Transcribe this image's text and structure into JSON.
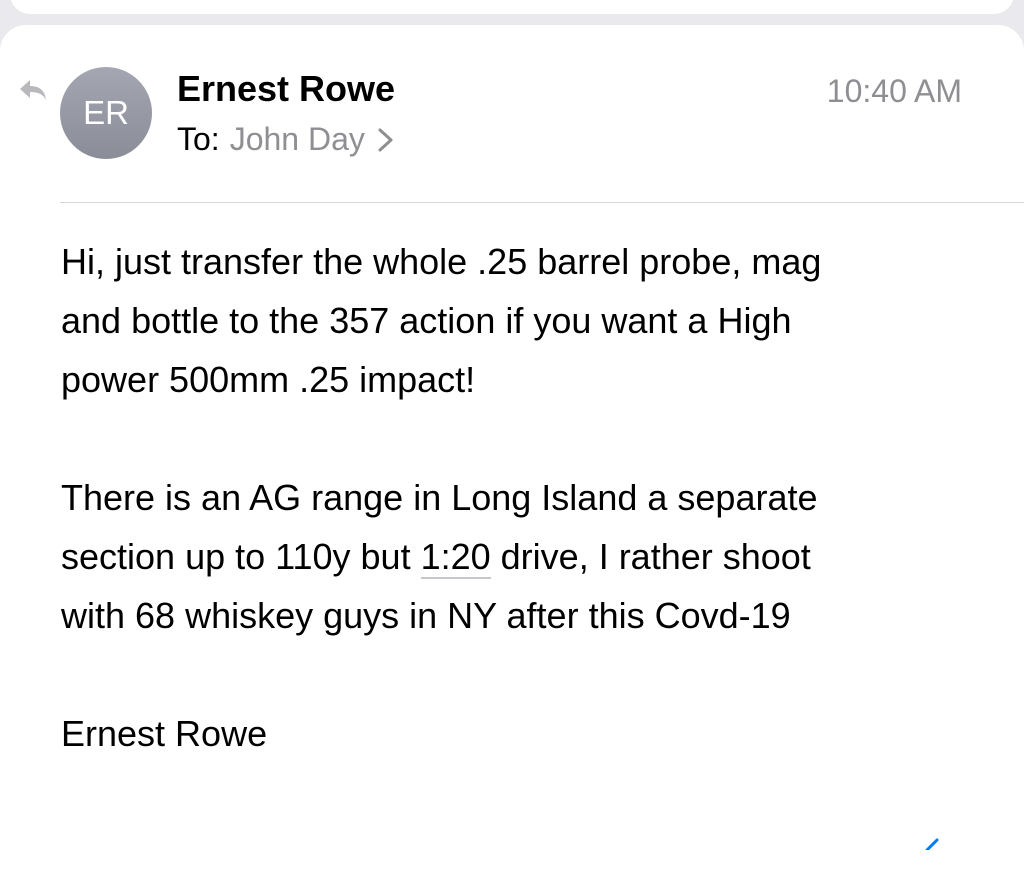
{
  "colors": {
    "background": "#e9e9ee",
    "card": "#ffffff",
    "secondary_text": "#8e8e93",
    "primary_text": "#000000",
    "avatar": "#9a9ca7",
    "accent": "#007aff"
  },
  "header": {
    "avatar_initials": "ER",
    "sender": "Ernest Rowe",
    "time": "10:40 AM",
    "to_label": "To:",
    "recipient": "John Day",
    "icons": {
      "reply": "reply-arrow-icon",
      "chevron": "chevron-right-icon"
    }
  },
  "message": {
    "p1": {
      "line1": "Hi, just transfer the whole .25 barrel probe, mag",
      "line2": "and bottle to the 357 action if you want a High",
      "line3": "power 500mm .25 impact!"
    },
    "p2": {
      "line1": "There is an AG range in Long Island a separate",
      "line2_before": "section up to 110y but ",
      "line2_link": "1:20",
      "line2_after": " drive, I rather shoot",
      "line3": "with 68 whiskey guys in NY after this Covd-19"
    },
    "signature": "Ernest Rowe"
  }
}
